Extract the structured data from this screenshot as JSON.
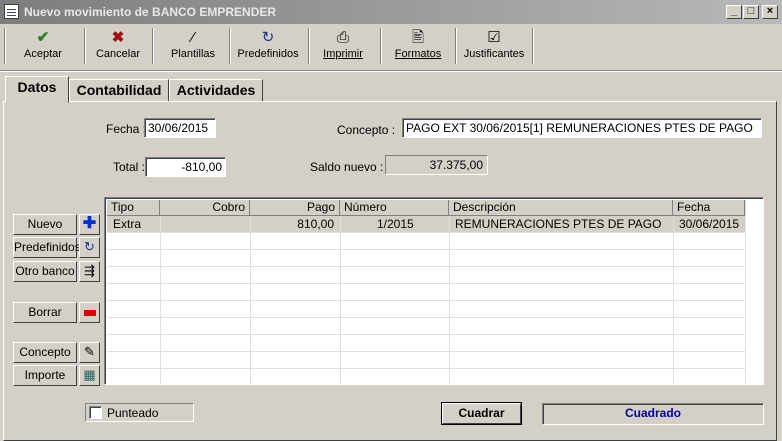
{
  "window": {
    "title": "Nuevo movimiento de BANCO EMPRENDER",
    "min": "_",
    "max": "□",
    "close": "×"
  },
  "toolbar": {
    "aceptar": "Aceptar",
    "cancelar": "Cancelar",
    "plantillas": "Plantillas",
    "predefinidos": "Predefinidos",
    "imprimir": "Imprimir",
    "formatos": "Formatos",
    "justificantes": "Justificantes"
  },
  "tabs": [
    "Datos",
    "Contabilidad",
    "Actividades"
  ],
  "form": {
    "fecha_label": "Fecha :",
    "fecha_value": "30/06/2015",
    "concepto_label": "Concepto :",
    "concepto_value": "PAGO EXT 30/06/2015[1] REMUNERACIONES PTES DE PAGO",
    "total_label": "Total :",
    "total_value": "-810,00",
    "saldo_label": "Saldo nuevo :",
    "saldo_value": "37.375,00"
  },
  "grid": {
    "columns": [
      "Tipo",
      "Cobro",
      "Pago",
      "Número",
      "Descripción",
      "Fecha"
    ],
    "rows": [
      {
        "tipo": "Extra",
        "cobro": "",
        "pago": "810,00",
        "numero": "1/2015",
        "descripcion": "REMUNERACIONES PTES DE PAGO",
        "fecha": "30/06/2015"
      }
    ]
  },
  "side_buttons": {
    "nuevo": "Nuevo",
    "predefinidos": "Predefinidos",
    "otro_banco": "Otro banco",
    "borrar": "Borrar",
    "concepto": "Concepto",
    "importe": "Importe"
  },
  "footer": {
    "punteado": "Punteado",
    "cuadrar": "Cuadrar",
    "status": "Cuadrado"
  },
  "colors": {
    "status_text": "#0000a0",
    "accept_green": "#208020",
    "cancel_red": "#a01010",
    "add_blue": "#0030d0",
    "delete_red": "#e00000"
  }
}
